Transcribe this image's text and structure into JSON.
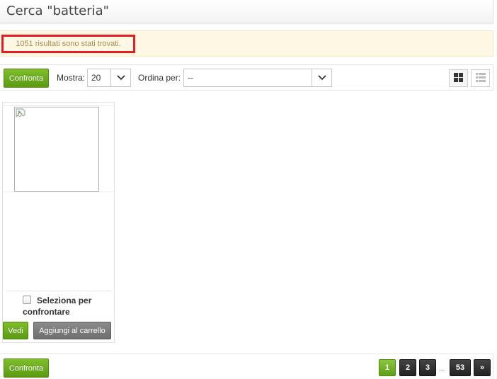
{
  "header": {
    "title": "Cerca \"batteria\""
  },
  "notice": {
    "results_text": "1051 risultati sono stati trovati."
  },
  "toolbar": {
    "compare_label": "Confronta",
    "show_label": "Mostra:",
    "show_value": "20",
    "sort_label": "Ordina per:",
    "sort_value": "--",
    "views": [
      {
        "name": "grid-view",
        "active": true
      },
      {
        "name": "list-view",
        "active": false
      }
    ]
  },
  "product": {
    "image_icon": "broken-image-icon",
    "compare_checkbox_label": "Seleziona per confrontare",
    "compare_checked": false,
    "view_button": "Vedi",
    "add_to_cart_button": "Aggiungi al carrello"
  },
  "footer": {
    "compare_label": "Confronta",
    "pages": [
      "1",
      "2",
      "3"
    ],
    "current_page": "1",
    "ellipsis": "...",
    "last_page": "53",
    "next_label": "»"
  },
  "colors": {
    "accent_green": "#6aab1e",
    "notice_bg": "#fdf7e3",
    "highlight_red": "#e51c23",
    "dark_button": "#333333"
  }
}
